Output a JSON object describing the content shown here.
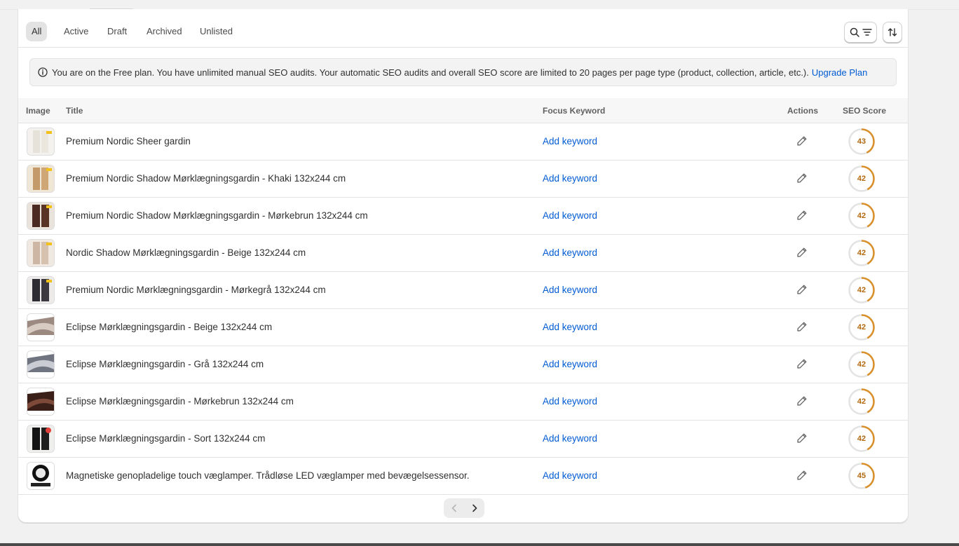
{
  "tabs": [
    {
      "label": "All",
      "active": true
    },
    {
      "label": "Active",
      "active": false
    },
    {
      "label": "Draft",
      "active": false
    },
    {
      "label": "Archived",
      "active": false
    },
    {
      "label": "Unlisted",
      "active": false
    }
  ],
  "toolbar": {
    "search_filter_icon": "search-filter-icon",
    "sort_icon": "sort-icon"
  },
  "banner": {
    "text": "You are on the Free plan. You have unlimited manual SEO audits. Your automatic SEO audits and overall SEO score are limited to 20 pages per page type (product, collection, article, etc.).",
    "link": "Upgrade Plan",
    "icon": "info-icon"
  },
  "table": {
    "headers": {
      "image": "Image",
      "title": "Title",
      "keyword": "Focus Keyword",
      "actions": "Actions",
      "score": "SEO Score"
    },
    "rows": [
      {
        "title": "Premium Nordic Sheer gardin",
        "keyword": "Add keyword",
        "score": 43,
        "thumb": "white-curtain"
      },
      {
        "title": "Premium Nordic Shadow Mørklægningsgardin - Khaki 132x244 cm",
        "keyword": "Add keyword",
        "score": 42,
        "thumb": "khaki-curtain"
      },
      {
        "title": "Premium Nordic Shadow Mørklægningsgardin - Mørkebrun 132x244 cm",
        "keyword": "Add keyword",
        "score": 42,
        "thumb": "brown-curtain"
      },
      {
        "title": "Nordic Shadow Mørklægningsgardin - Beige 132x244 cm",
        "keyword": "Add keyword",
        "score": 42,
        "thumb": "beige-curtain"
      },
      {
        "title": "Premium Nordic Mørklægningsgardin - Mørkegrå 132x244 cm",
        "keyword": "Add keyword",
        "score": 42,
        "thumb": "grey-curtain"
      },
      {
        "title": "Eclipse Mørklægningsgardin - Beige 132x244 cm",
        "keyword": "Add keyword",
        "score": 42,
        "thumb": "beige-fabric"
      },
      {
        "title": "Eclipse Mørklægningsgardin - Grå 132x244 cm",
        "keyword": "Add keyword",
        "score": 42,
        "thumb": "grey-fabric"
      },
      {
        "title": "Eclipse Mørklægningsgardin - Mørkebrun 132x244 cm",
        "keyword": "Add keyword",
        "score": 42,
        "thumb": "brown-fabric"
      },
      {
        "title": "Eclipse Mørklægningsgardin - Sort 132x244 cm",
        "keyword": "Add keyword",
        "score": 42,
        "thumb": "black-curtain"
      },
      {
        "title": "Magnetiske genopladelige touch væglamper. Trådløse LED væglamper med bevægelsessensor.",
        "keyword": "Add keyword",
        "score": 45,
        "thumb": "wall-lamp"
      }
    ]
  },
  "colors": {
    "accent_link": "#005bd3",
    "score_ring": "#d98f2a",
    "score_text": "#b4690e",
    "ring_track": "#e3e3e3"
  },
  "pagination": {
    "prev_icon": "chevron-left-icon",
    "next_icon": "chevron-right-icon"
  }
}
